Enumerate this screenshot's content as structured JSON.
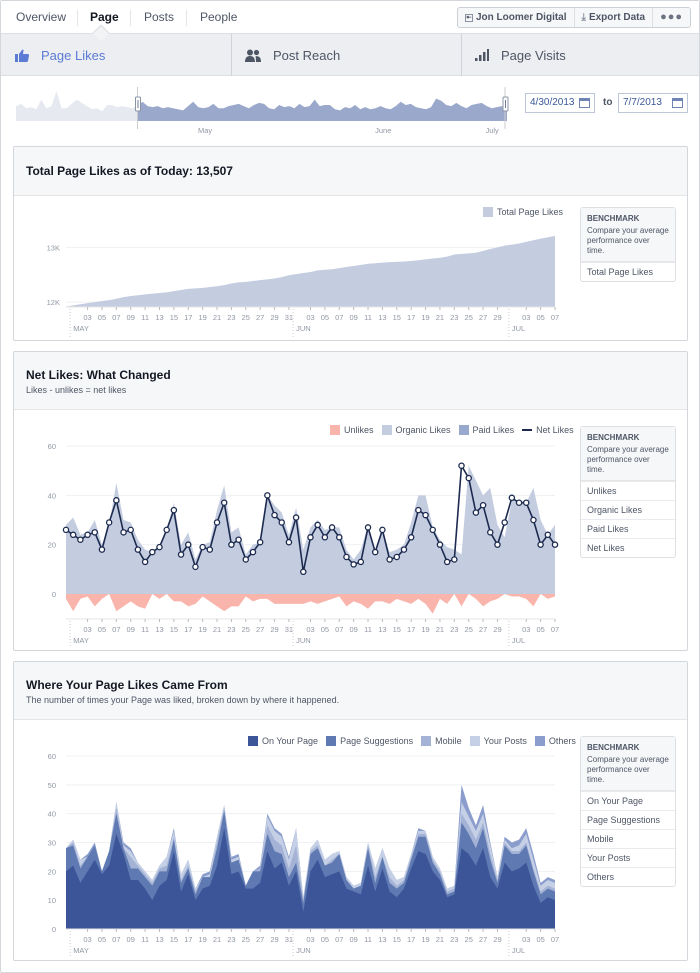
{
  "topnav": {
    "tabs": [
      {
        "label": "Overview",
        "active": false
      },
      {
        "label": "Page",
        "active": true
      },
      {
        "label": "Posts",
        "active": false
      },
      {
        "label": "People",
        "active": false
      }
    ],
    "actions": {
      "page_name": "Jon Loomer Digital",
      "export_label": "Export Data",
      "more_label": "●●●"
    }
  },
  "sections": [
    {
      "label": "Page Likes",
      "icon": "thumbs-up-icon",
      "active": true
    },
    {
      "label": "Post Reach",
      "icon": "people-icon",
      "active": false
    },
    {
      "label": "Page Visits",
      "icon": "bar-signal-icon",
      "active": false
    }
  ],
  "range_selector": {
    "month_labels": [
      "May",
      "June",
      "July"
    ],
    "start_date": "4/30/2013",
    "end_date": "7/7/2013",
    "to_label": "to",
    "overview_values": [
      14,
      16,
      12,
      13,
      11,
      20,
      12,
      14,
      28,
      12,
      12,
      16,
      20,
      17,
      14,
      11,
      12,
      9,
      15,
      15,
      13,
      14,
      13,
      12,
      14,
      18,
      14,
      13,
      14,
      12,
      13,
      12,
      11,
      10,
      14,
      18,
      13,
      12,
      13,
      16,
      12,
      12,
      14,
      15,
      16,
      14,
      12,
      15,
      17,
      16,
      12,
      11,
      15,
      13,
      14,
      12,
      16,
      13,
      14,
      20,
      14,
      15,
      15,
      11,
      10,
      13,
      12,
      15,
      11,
      13,
      11,
      12,
      14,
      12,
      11,
      14,
      18,
      15,
      16,
      13,
      12,
      11,
      13,
      21,
      19,
      15,
      14,
      17,
      14,
      12,
      15,
      16,
      17,
      14,
      12,
      13,
      14,
      12
    ]
  },
  "colors": {
    "accent": "#5b7bd5",
    "area_light": "#c4cde0",
    "area_paid": "#99a9cd",
    "unlikes": "#f9b5ac",
    "net_line": "#1c2a4f",
    "on_your_page": "#3b5598",
    "page_suggestions": "#5f79b2",
    "mobile": "#a4b3d5",
    "your_posts": "#c5d0e6",
    "others": "#8a9dcc"
  },
  "cards": {
    "total": {
      "title": "Total Page Likes as of Today: 13,507",
      "legend": [
        "Total Page Likes"
      ],
      "bench_title": "BENCHMARK",
      "bench_desc": "Compare your average performance over time.",
      "bench_items": [
        "Total Page Likes"
      ]
    },
    "net": {
      "title": "Net Likes: What Changed",
      "subtitle": "Likes - unlikes = net likes",
      "legend": [
        "Unlikes",
        "Organic Likes",
        "Paid Likes",
        "Net Likes"
      ],
      "bench_title": "BENCHMARK",
      "bench_desc": "Compare your average performance over time.",
      "bench_items": [
        "Unlikes",
        "Organic Likes",
        "Paid Likes",
        "Net Likes"
      ]
    },
    "source": {
      "title": "Where Your Page Likes Came From",
      "subtitle": "The number of times your Page was liked, broken down by where it happened.",
      "legend": [
        "On Your Page",
        "Page Suggestions",
        "Mobile",
        "Your Posts",
        "Others"
      ],
      "bench_title": "BENCHMARK",
      "bench_desc": "Compare your average performance over time.",
      "bench_items": [
        "On Your Page",
        "Page Suggestions",
        "Mobile",
        "Your Posts",
        "Others"
      ]
    }
  },
  "chart_data": [
    {
      "type": "area",
      "title": "Total Page Likes as of Today: 13,507",
      "x_start": "2013-04-30",
      "x_end": "2013-07-07",
      "x_tick_labels": [
        "03",
        "05",
        "07",
        "09",
        "11",
        "13",
        "15",
        "17",
        "19",
        "21",
        "23",
        "25",
        "27",
        "29",
        "31",
        "03",
        "05",
        "07",
        "09",
        "11",
        "13",
        "15",
        "17",
        "19",
        "21",
        "23",
        "25",
        "27",
        "29",
        "03",
        "05",
        "07"
      ],
      "month_labels": [
        "MAY",
        "JUN",
        "JUL"
      ],
      "y_tick_labels": [
        "12K",
        "13K"
      ],
      "ylim": [
        11910,
        13700
      ],
      "grid": true,
      "legend_position": "top-right",
      "series": [
        {
          "name": "Total Page Likes",
          "values": [
            11920,
            11940,
            11960,
            11980,
            12000,
            12020,
            12035,
            12060,
            12090,
            12110,
            12125,
            12140,
            12155,
            12165,
            12180,
            12200,
            12220,
            12240,
            12250,
            12260,
            12275,
            12290,
            12310,
            12340,
            12360,
            12370,
            12385,
            12400,
            12415,
            12430,
            12455,
            12490,
            12510,
            12530,
            12550,
            12580,
            12590,
            12600,
            12620,
            12640,
            12660,
            12680,
            12700,
            12710,
            12720,
            12730,
            12735,
            12740,
            12750,
            12765,
            12780,
            12795,
            12810,
            12830,
            12870,
            12880,
            12890,
            12900,
            12935,
            12970,
            13000,
            13030,
            13050,
            13070,
            13100,
            13130,
            13160,
            13185,
            13210,
            13215,
            13220
          ]
        }
      ]
    },
    {
      "type": "area",
      "title": "Net Likes: What Changed",
      "x_start": "2013-04-30",
      "x_end": "2013-07-07",
      "x_tick_labels": [
        "03",
        "05",
        "07",
        "09",
        "11",
        "13",
        "15",
        "17",
        "19",
        "21",
        "23",
        "25",
        "27",
        "29",
        "31",
        "03",
        "05",
        "07",
        "09",
        "11",
        "13",
        "15",
        "17",
        "19",
        "21",
        "23",
        "25",
        "27",
        "29",
        "03",
        "05",
        "07"
      ],
      "month_labels": [
        "MAY",
        "JUN",
        "JUL"
      ],
      "y_tick_labels": [
        "0",
        "20",
        "40",
        "60"
      ],
      "ylim": [
        -10,
        60
      ],
      "grid": true,
      "legend_position": "top-right",
      "series": [
        {
          "name": "Organic Likes",
          "values": [
            28,
            31,
            24,
            25,
            30,
            20,
            28,
            45,
            30,
            29,
            22,
            18,
            17,
            20,
            26,
            37,
            20,
            25,
            14,
            20,
            21,
            34,
            44,
            25,
            27,
            16,
            20,
            21,
            40,
            36,
            33,
            24,
            35,
            18,
            27,
            30,
            26,
            27,
            27,
            18,
            14,
            18,
            28,
            18,
            26,
            17,
            18,
            20,
            29,
            40,
            40,
            27,
            22,
            19,
            18,
            16,
            52,
            46,
            40,
            43,
            28,
            23,
            38,
            38,
            37,
            43,
            30,
            24,
            28
          ]
        },
        {
          "name": "Paid Likes",
          "values": [
            0,
            0,
            0,
            0,
            0,
            0,
            0,
            0,
            0,
            0,
            0,
            0,
            0,
            0,
            0,
            0,
            0,
            0,
            0,
            0,
            0,
            0,
            0,
            0,
            0,
            0,
            0,
            0,
            0,
            0,
            0,
            0,
            0,
            0,
            0,
            0,
            0,
            0,
            0,
            0,
            0,
            0,
            0,
            0,
            0,
            0,
            0,
            0,
            0,
            0,
            0,
            0,
            0,
            0,
            0,
            0,
            0,
            0,
            0,
            0,
            0,
            0,
            0,
            0,
            0,
            0,
            0,
            0,
            0
          ]
        },
        {
          "name": "Unlikes",
          "values": [
            -2,
            -7,
            -2,
            -1,
            -5,
            -2,
            0,
            -7,
            -5,
            -3,
            -5,
            -6,
            0,
            -2,
            0,
            -3,
            -3,
            -5,
            -4,
            -1,
            -3,
            -5,
            -7,
            -5,
            -5,
            -1,
            -3,
            -2,
            -2,
            -4,
            -4,
            -4,
            -4,
            -4,
            -3,
            -4,
            -3,
            -2,
            -1,
            -5,
            -3,
            -4,
            -6,
            -3,
            -3,
            -4,
            -2,
            -3,
            -4,
            -2,
            -4,
            -8,
            -2,
            -4,
            0,
            -5,
            0,
            -2,
            -5,
            -3,
            -2,
            0,
            -1,
            -1,
            -2,
            -5,
            0,
            -2,
            -1
          ]
        },
        {
          "name": "Net Likes",
          "values": [
            26,
            24,
            22,
            24,
            25,
            18,
            29,
            38,
            25,
            26,
            18,
            13,
            17,
            19,
            26,
            34,
            16,
            20,
            11,
            19,
            18,
            29,
            37,
            20,
            22,
            14,
            17,
            21,
            40,
            32,
            29,
            21,
            31,
            9,
            23,
            28,
            23,
            27,
            23,
            15,
            12,
            13,
            27,
            17,
            26,
            14,
            15,
            18,
            23,
            34,
            32,
            26,
            20,
            13,
            14,
            52,
            47,
            33,
            36,
            25,
            20,
            29,
            39,
            37,
            37,
            30,
            20,
            24,
            20
          ]
        }
      ]
    },
    {
      "type": "area",
      "title": "Where Your Page Likes Came From",
      "stacked": true,
      "x_start": "2013-04-30",
      "x_end": "2013-07-07",
      "x_tick_labels": [
        "03",
        "05",
        "07",
        "09",
        "11",
        "13",
        "15",
        "17",
        "19",
        "21",
        "23",
        "25",
        "27",
        "29",
        "31",
        "03",
        "05",
        "07",
        "09",
        "11",
        "13",
        "15",
        "17",
        "19",
        "21",
        "23",
        "25",
        "27",
        "29",
        "03",
        "05",
        "07"
      ],
      "month_labels": [
        "MAY",
        "JUN",
        "JUL"
      ],
      "y_tick_labels": [
        "0",
        "10",
        "20",
        "30",
        "40",
        "50",
        "60"
      ],
      "ylim": [
        0,
        60
      ],
      "grid": true,
      "legend_position": "top-right",
      "series": [
        {
          "name": "On Your Page",
          "values": [
            20,
            22,
            16,
            20,
            24,
            19,
            22,
            33,
            26,
            17,
            17,
            14,
            10,
            15,
            17,
            27,
            13,
            19,
            10,
            14,
            15,
            22,
            35,
            19,
            20,
            14,
            14,
            16,
            27,
            21,
            23,
            15,
            20,
            6,
            20,
            24,
            18,
            19,
            20,
            14,
            13,
            12,
            22,
            13,
            21,
            13,
            11,
            14,
            21,
            27,
            26,
            20,
            17,
            11,
            12,
            28,
            26,
            22,
            28,
            18,
            14,
            23,
            20,
            21,
            23,
            15,
            9,
            11,
            10
          ]
        },
        {
          "name": "Page Suggestions",
          "values": [
            8,
            7,
            5,
            5,
            5,
            1,
            5,
            7,
            2,
            4,
            4,
            4,
            5,
            5,
            3,
            4,
            3,
            2,
            2,
            4,
            3,
            6,
            6,
            4,
            4,
            1,
            6,
            4,
            6,
            6,
            3,
            3,
            3,
            3,
            6,
            4,
            4,
            4,
            6,
            3,
            1,
            3,
            6,
            3,
            4,
            3,
            3,
            2,
            3,
            5,
            6,
            3,
            2,
            1,
            1,
            9,
            7,
            6,
            7,
            6,
            2,
            6,
            6,
            5,
            6,
            5,
            3,
            3,
            3
          ]
        },
        {
          "name": "Mobile",
          "values": [
            0,
            1,
            1,
            0,
            0,
            0,
            0,
            2,
            0,
            4,
            1,
            1,
            1,
            1,
            2,
            1,
            1,
            1,
            1,
            0,
            0,
            2,
            1,
            0,
            0,
            0,
            0,
            1,
            3,
            4,
            3,
            3,
            6,
            1,
            1,
            1,
            0,
            1,
            0,
            0,
            0,
            0,
            1,
            2,
            0,
            2,
            1,
            1,
            1,
            1,
            1,
            1,
            1,
            1,
            1,
            3,
            3,
            3,
            2,
            2,
            1,
            1,
            1,
            1,
            1,
            1,
            1,
            1,
            1
          ]
        },
        {
          "name": "Your Posts",
          "values": [
            0,
            1,
            2,
            0,
            0,
            0,
            0,
            2,
            1,
            2,
            1,
            1,
            1,
            1,
            3,
            2,
            2,
            2,
            1,
            0,
            1,
            2,
            1,
            1,
            1,
            0,
            0,
            0,
            3,
            3,
            3,
            3,
            6,
            1,
            1,
            2,
            2,
            2,
            1,
            1,
            1,
            1,
            1,
            3,
            3,
            3,
            2,
            1,
            1,
            1,
            1,
            1,
            1,
            1,
            1,
            4,
            3,
            3,
            3,
            3,
            1,
            1,
            1,
            2,
            3,
            3,
            2,
            2,
            2
          ]
        },
        {
          "name": "Others",
          "values": [
            0,
            0,
            0,
            1,
            1,
            0,
            0,
            0,
            1,
            1,
            0,
            0,
            0,
            0,
            0,
            1,
            0,
            0,
            0,
            1,
            1,
            0,
            0,
            1,
            1,
            0,
            0,
            1,
            1,
            1,
            1,
            1,
            0,
            0,
            0,
            0,
            0,
            0,
            0,
            0,
            0,
            0,
            0,
            0,
            0,
            0,
            0,
            0,
            0,
            1,
            0,
            0,
            0,
            0,
            0,
            6,
            3,
            2,
            3,
            1,
            0,
            1,
            2,
            2,
            2,
            2,
            1,
            1,
            1
          ]
        }
      ]
    }
  ]
}
